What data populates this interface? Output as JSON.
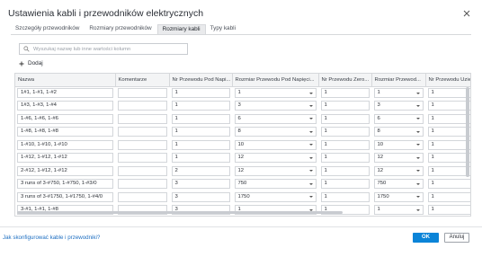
{
  "dialog": {
    "title": "Ustawienia kabli i przewodników elektrycznych"
  },
  "tabs": [
    {
      "label": "Szczegóły przewodników"
    },
    {
      "label": "Rozmiary przewodników"
    },
    {
      "label": "Rozmiary kabli"
    },
    {
      "label": "Typy kabli"
    }
  ],
  "active_tab": "Rozmiary kabli",
  "search": {
    "placeholder": "Wyszukaj nazwę lub inne wartości kolumn",
    "value": ""
  },
  "add_button": {
    "label": "Dodaj"
  },
  "table": {
    "columns": [
      {
        "label": "Nazwa"
      },
      {
        "label": "Komentarze"
      },
      {
        "label": "Nr Przewodu Pod Napi..."
      },
      {
        "label": "Rozmiar Przewodu Pod Napięci..."
      },
      {
        "label": "Nr Przewodu Zero..."
      },
      {
        "label": "Rozmiar Przewod..."
      },
      {
        "label": "Nr Przewodu Uzien"
      }
    ],
    "rows": [
      {
        "name": "1#1, 1-#1, 1-#2",
        "comment": "",
        "n_hot": "1",
        "hot_size": "1",
        "n_neutral": "1",
        "neutral_size": "1",
        "n_ground": "1"
      },
      {
        "name": "1#3, 1-#3, 1-#4",
        "comment": "",
        "n_hot": "1",
        "hot_size": "3",
        "n_neutral": "1",
        "neutral_size": "3",
        "n_ground": "1"
      },
      {
        "name": "1-#6, 1-#6, 1-#6",
        "comment": "",
        "n_hot": "1",
        "hot_size": "6",
        "n_neutral": "1",
        "neutral_size": "6",
        "n_ground": "1"
      },
      {
        "name": "1-#8, 1-#8, 1-#8",
        "comment": "",
        "n_hot": "1",
        "hot_size": "8",
        "n_neutral": "1",
        "neutral_size": "8",
        "n_ground": "1"
      },
      {
        "name": "1-#10, 1-#10, 1-#10",
        "comment": "",
        "n_hot": "1",
        "hot_size": "10",
        "n_neutral": "1",
        "neutral_size": "10",
        "n_ground": "1"
      },
      {
        "name": "1-#12, 1-#12, 1-#12",
        "comment": "",
        "n_hot": "1",
        "hot_size": "12",
        "n_neutral": "1",
        "neutral_size": "12",
        "n_ground": "1"
      },
      {
        "name": "2-#12, 1-#12, 1-#12",
        "comment": "",
        "n_hot": "2",
        "hot_size": "12",
        "n_neutral": "1",
        "neutral_size": "12",
        "n_ground": "1"
      },
      {
        "name": "3 runs of 3-#750, 1-#750, 1-#3/0",
        "comment": "",
        "n_hot": "3",
        "hot_size": "750",
        "n_neutral": "1",
        "neutral_size": "750",
        "n_ground": "1"
      },
      {
        "name": "3 runs of 3-#1750, 1-#1750, 1-#4/0",
        "comment": "",
        "n_hot": "3",
        "hot_size": "1750",
        "n_neutral": "1",
        "neutral_size": "1750",
        "n_ground": "1"
      },
      {
        "name": "3-#1, 1-#1, 1-#8",
        "comment": "",
        "n_hot": "3",
        "hot_size": "1",
        "n_neutral": "1",
        "neutral_size": "1",
        "n_ground": "1"
      },
      {
        "name": "3-#2, 1-#2, 1-#2",
        "comment": "",
        "n_hot": "3",
        "hot_size": "2",
        "n_neutral": "1",
        "neutral_size": "2",
        "n_ground": "1"
      }
    ]
  },
  "footer": {
    "help_link": "Jak skonfigurować kable i przewodniki?",
    "ok_label": "OK",
    "cancel_label": "Anuluj"
  },
  "colors": {
    "accent": "#0b84d8",
    "link": "#1e6fc2"
  },
  "icons": {
    "close": "close-icon",
    "search": "search-icon",
    "add": "plus-icon",
    "dropdown": "chevron-down-icon"
  }
}
